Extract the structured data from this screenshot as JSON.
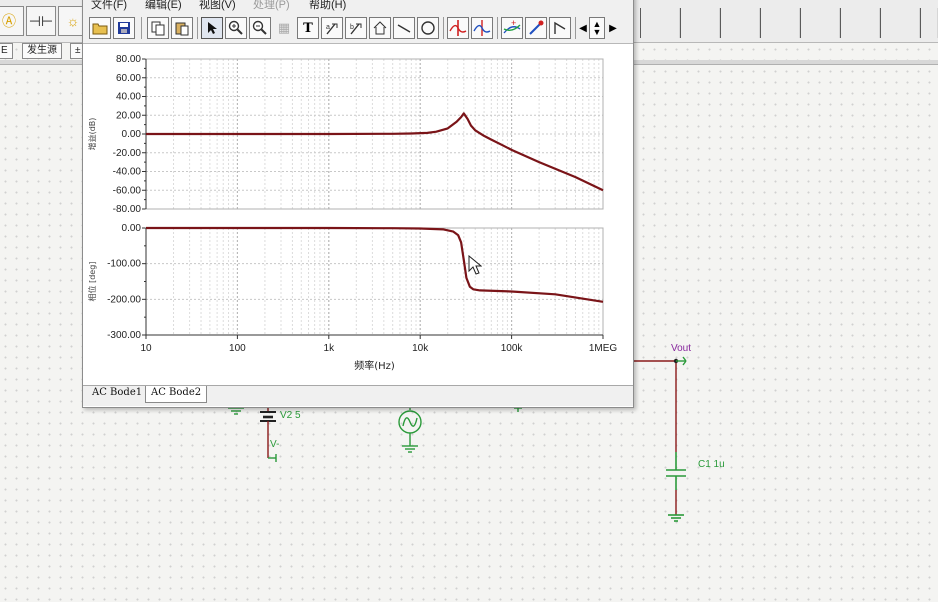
{
  "toolbar": {
    "tabs": [
      "E",
      "发生源",
      "±"
    ]
  },
  "bode_window": {
    "menu": [
      "文件(F)",
      "编辑(E)",
      "视图(V)",
      "处理(P)",
      "帮助(H)"
    ],
    "tabs": [
      "AC Bode1",
      "AC Bode2"
    ],
    "active_tab": "AC Bode2",
    "icons": [
      "open-folder-icon",
      "save-icon",
      "copy-icon",
      "paste-icon",
      "pointer-icon",
      "zoom-in-icon",
      "zoom-out-icon",
      "text-icon",
      "cursor-a-icon",
      "cursor-b-icon",
      "house-icon",
      "line-icon",
      "circle-icon",
      "crosshair-red-icon",
      "crosshair-blue-icon",
      "curve-plus-icon",
      "probe-icon",
      "flag-icon",
      "scroll-left-icon",
      "scroll-updown-icon",
      "scroll-right-icon"
    ]
  },
  "schematic": {
    "labels": {
      "vout": "Vout",
      "v2": "V2 5",
      "vminus": "V-",
      "c1": "C1 1u"
    }
  },
  "chart_data": [
    {
      "type": "line",
      "title": "",
      "xlabel": "",
      "ylabel": "增益(dB)",
      "x_scale": "log",
      "xlim": [
        10,
        1000000
      ],
      "ylim": [
        -80,
        80
      ],
      "yticks": [
        80,
        60,
        40,
        20,
        0,
        -20,
        -40,
        -60,
        -80
      ],
      "ytick_labels": [
        "80.00",
        "60.00",
        "40.00",
        "20.00",
        "0.00",
        "-20.00",
        "-40.00",
        "-60.00",
        "-80.00"
      ],
      "grid": true,
      "series": [
        {
          "color": "#7a1418",
          "x": [
            10,
            100,
            1000,
            5000,
            8000,
            12000,
            15000,
            20000,
            25000,
            28000,
            30000,
            33000,
            36000,
            40000,
            50000,
            60000,
            80000,
            100000,
            200000,
            500000,
            1000000
          ],
          "y": [
            0,
            0,
            0,
            0.2,
            0.5,
            1.2,
            2.5,
            6,
            13,
            18,
            22,
            16,
            9,
            4,
            -2,
            -6,
            -12,
            -17,
            -30,
            -46,
            -60
          ]
        }
      ]
    },
    {
      "type": "line",
      "title": "",
      "xlabel": "频率(Hz)",
      "ylabel": "相位 [deg]",
      "x_scale": "log",
      "xlim": [
        10,
        1000000
      ],
      "ylim": [
        -300,
        0
      ],
      "yticks": [
        0,
        -100,
        -200,
        -300
      ],
      "ytick_labels": [
        "0.00",
        "-100.00",
        "-200.00",
        "-300.00"
      ],
      "xtick_labels": [
        "10",
        "100",
        "1k",
        "10k",
        "100k",
        "1MEG"
      ],
      "xticks": [
        10,
        100,
        1000,
        10000,
        100000,
        1000000
      ],
      "grid": true,
      "series": [
        {
          "color": "#7a1418",
          "x": [
            10,
            100,
            1000,
            5000,
            10000,
            18000,
            23000,
            26000,
            28000,
            30000,
            32000,
            35000,
            38000,
            45000,
            100000,
            300000,
            1000000
          ],
          "y": [
            0,
            0,
            0,
            -0.5,
            -1.5,
            -4,
            -10,
            -20,
            -40,
            -90,
            -140,
            -165,
            -172,
            -175,
            -178,
            -186,
            -207
          ]
        }
      ]
    }
  ]
}
